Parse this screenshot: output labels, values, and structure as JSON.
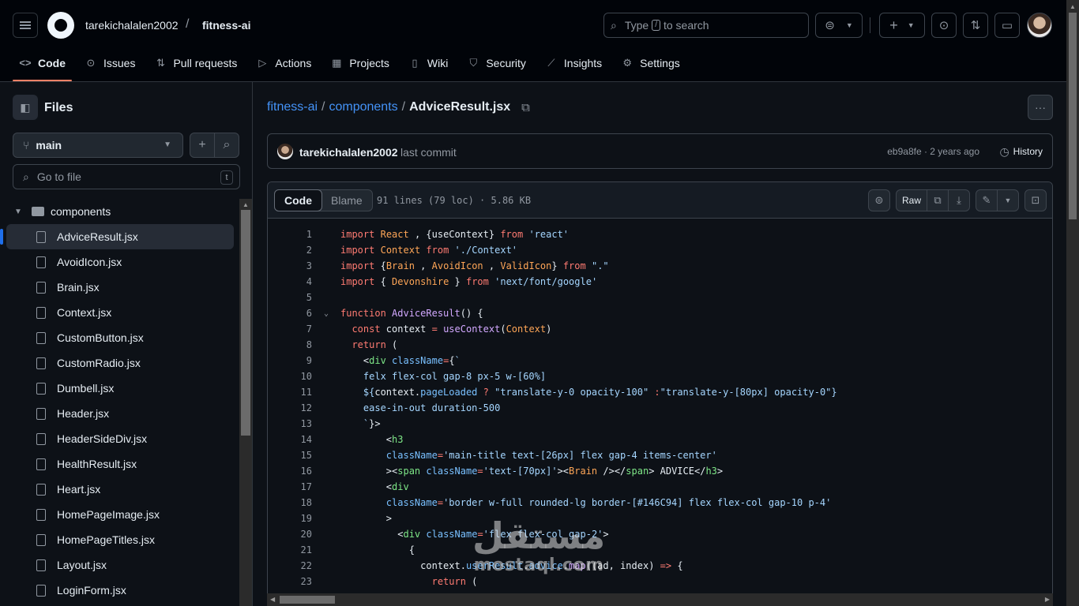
{
  "header": {
    "owner": "tarekichalalen2002",
    "separator": "/",
    "repo": "fitness-ai",
    "search_placeholder_before": "Type",
    "search_key": "/",
    "search_placeholder_after": "to search"
  },
  "repo_nav": [
    {
      "label": "Code",
      "icon": "code-icon",
      "glyph": "<>"
    },
    {
      "label": "Issues",
      "icon": "issue-icon",
      "glyph": "⊙"
    },
    {
      "label": "Pull requests",
      "icon": "pull-request-icon",
      "glyph": "⇅"
    },
    {
      "label": "Actions",
      "icon": "play-icon",
      "glyph": "▷"
    },
    {
      "label": "Projects",
      "icon": "table-icon",
      "glyph": "▦"
    },
    {
      "label": "Wiki",
      "icon": "book-icon",
      "glyph": "▯"
    },
    {
      "label": "Security",
      "icon": "shield-icon",
      "glyph": "⛉"
    },
    {
      "label": "Insights",
      "icon": "graph-icon",
      "glyph": "⟋"
    },
    {
      "label": "Settings",
      "icon": "gear-icon",
      "glyph": "⚙"
    }
  ],
  "sidebar": {
    "title": "Files",
    "branch": "main",
    "go_to_file": "Go to file",
    "go_to_file_key": "t",
    "folder": "components",
    "files": [
      "AdviceResult.jsx",
      "AvoidIcon.jsx",
      "Brain.jsx",
      "Context.jsx",
      "CustomButton.jsx",
      "CustomRadio.jsx",
      "Dumbell.jsx",
      "Header.jsx",
      "HeaderSideDiv.jsx",
      "HealthResult.jsx",
      "Heart.jsx",
      "HomePageImage.jsx",
      "HomePageTitles.jsx",
      "Layout.jsx",
      "LoginForm.jsx"
    ],
    "selected_file": "AdviceResult.jsx"
  },
  "breadcrumb": {
    "repo": "fitness-ai",
    "folder": "components",
    "file": "AdviceResult.jsx",
    "sep": "/"
  },
  "commit": {
    "user": "tarekichalalen2002",
    "message": "last commit",
    "meta": "eb9a8fe · 2 years ago",
    "history": "History"
  },
  "viewer": {
    "tab_code": "Code",
    "tab_blame": "Blame",
    "file_info": "91 lines (79 loc) · 5.86 KB",
    "raw": "Raw"
  },
  "code_lines": [
    {
      "n": "1",
      "fold": "",
      "html": "<span class=\"kw\">import</span> <span class=\"cls\">React</span> , {useContext} <span class=\"kw\">from</span> <span class=\"str\">'react'</span>"
    },
    {
      "n": "2",
      "fold": "",
      "html": "<span class=\"kw\">import</span> <span class=\"cls\">Context</span> <span class=\"kw\">from</span> <span class=\"str\">'./Context'</span>"
    },
    {
      "n": "3",
      "fold": "",
      "html": "<span class=\"kw\">import</span> {<span class=\"cls\">Brain</span> , <span class=\"cls\">AvoidIcon</span> , <span class=\"cls\">ValidIcon</span>} <span class=\"kw\">from</span> <span class=\"str\">\".\"</span>"
    },
    {
      "n": "4",
      "fold": "",
      "html": "<span class=\"kw\">import</span> { <span class=\"cls\">Devonshire</span> } <span class=\"kw\">from</span> <span class=\"str\">'next/font/google'</span>"
    },
    {
      "n": "5",
      "fold": "",
      "html": ""
    },
    {
      "n": "6",
      "fold": "⌄",
      "html": "<span class=\"kw\">function</span> <span class=\"fn\">AdviceResult</span>() {"
    },
    {
      "n": "7",
      "fold": "",
      "html": "  <span class=\"kw\">const</span> context <span class=\"kw\">=</span> <span class=\"fn\">useContext</span>(<span class=\"cls\">Context</span>)"
    },
    {
      "n": "8",
      "fold": "",
      "html": "  <span class=\"kw\">return</span> ("
    },
    {
      "n": "9",
      "fold": "",
      "html": "    &lt;<span class=\"tag\">div</span> <span class=\"attr\">className</span><span class=\"kw\">=</span>{<span class=\"str\">`</span>"
    },
    {
      "n": "10",
      "fold": "",
      "html": "    <span class=\"str\">felx flex-col gap-8 px-5 w-[60%]</span>"
    },
    {
      "n": "11",
      "fold": "",
      "html": "    <span class=\"str\">${</span>context.<span class=\"attr\">pageLoaded</span> <span class=\"kw\">?</span> <span class=\"str\">\"translate-y-0 opacity-100\"</span> <span class=\"kw\">:</span><span class=\"str\">\"translate-y-[80px] opacity-0\"</span><span class=\"str\">}</span>"
    },
    {
      "n": "12",
      "fold": "",
      "html": "    <span class=\"str\">ease-in-out duration-500</span>"
    },
    {
      "n": "13",
      "fold": "",
      "html": "    <span class=\"str\">`</span>}&gt;"
    },
    {
      "n": "14",
      "fold": "",
      "html": "        &lt;<span class=\"tag\">h3</span>"
    },
    {
      "n": "15",
      "fold": "",
      "html": "        <span class=\"attr\">className</span><span class=\"kw\">=</span><span class=\"str\">'main-title text-[26px] flex gap-4 items-center'</span>"
    },
    {
      "n": "16",
      "fold": "",
      "html": "        &gt;&lt;<span class=\"tag\">span</span> <span class=\"attr\">className</span><span class=\"kw\">=</span><span class=\"str\">'text-[70px]'</span>&gt;&lt;<span class=\"cls\">Brain</span> /&gt;&lt;/<span class=\"tag\">span</span>&gt; ADVICE&lt;/<span class=\"tag\">h3</span>&gt;"
    },
    {
      "n": "17",
      "fold": "",
      "html": "        &lt;<span class=\"tag\">div</span>"
    },
    {
      "n": "18",
      "fold": "",
      "html": "        <span class=\"attr\">className</span><span class=\"kw\">=</span><span class=\"str\">'border w-full rounded-lg border-[#146C94] flex flex-col gap-10 p-4'</span>"
    },
    {
      "n": "19",
      "fold": "",
      "html": "        &gt;"
    },
    {
      "n": "20",
      "fold": "",
      "html": "          &lt;<span class=\"tag\">div</span> <span class=\"attr\">className</span><span class=\"kw\">=</span><span class=\"str\">'flex flex-col gap-2'</span>&gt;"
    },
    {
      "n": "21",
      "fold": "",
      "html": "            {"
    },
    {
      "n": "22",
      "fold": "",
      "html": "              context.<span class=\"attr\">userResult</span>.<span class=\"attr\">advice</span>.<span class=\"fn\">map</span>((ad, index) <span class=\"kw\">=&gt;</span> {"
    },
    {
      "n": "23",
      "fold": "",
      "html": "                <span class=\"kw\">return</span> ("
    }
  ],
  "watermark": {
    "arabic": "مستقل",
    "latin": "mostaql.com"
  }
}
